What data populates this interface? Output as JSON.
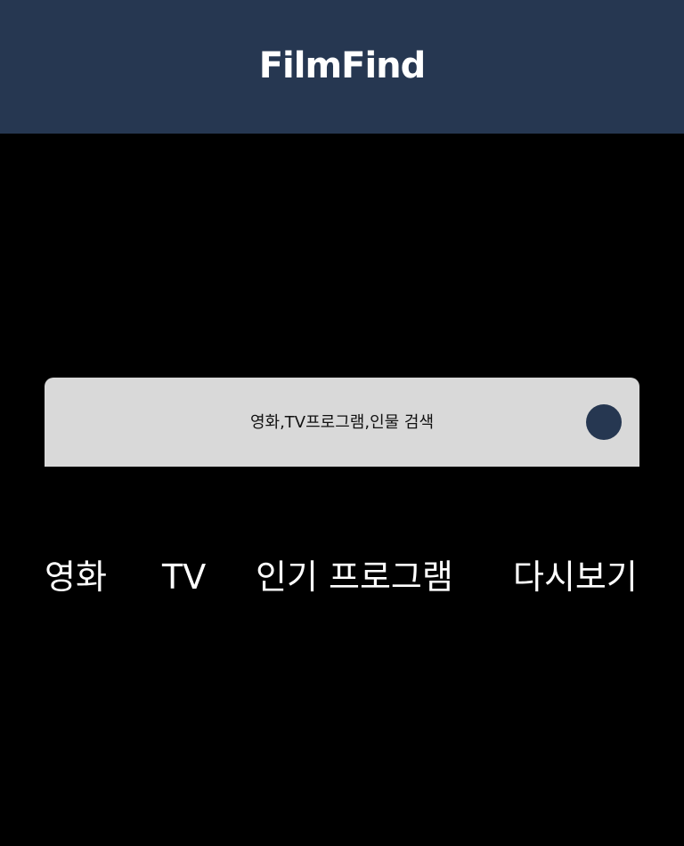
{
  "header": {
    "logo_text": "FilmFind"
  },
  "search": {
    "placeholder": "영화,TV프로그램,인물 검색",
    "value": ""
  },
  "nav": {
    "items": [
      {
        "label": "영화"
      },
      {
        "label": "TV"
      },
      {
        "label": "인기 프로그램"
      },
      {
        "label": "다시보기"
      }
    ]
  },
  "colors": {
    "header_bg": "#263751",
    "page_bg": "#000000",
    "search_bg": "#d9d9d9",
    "search_button": "#263751",
    "nav_text": "#ffffff"
  }
}
